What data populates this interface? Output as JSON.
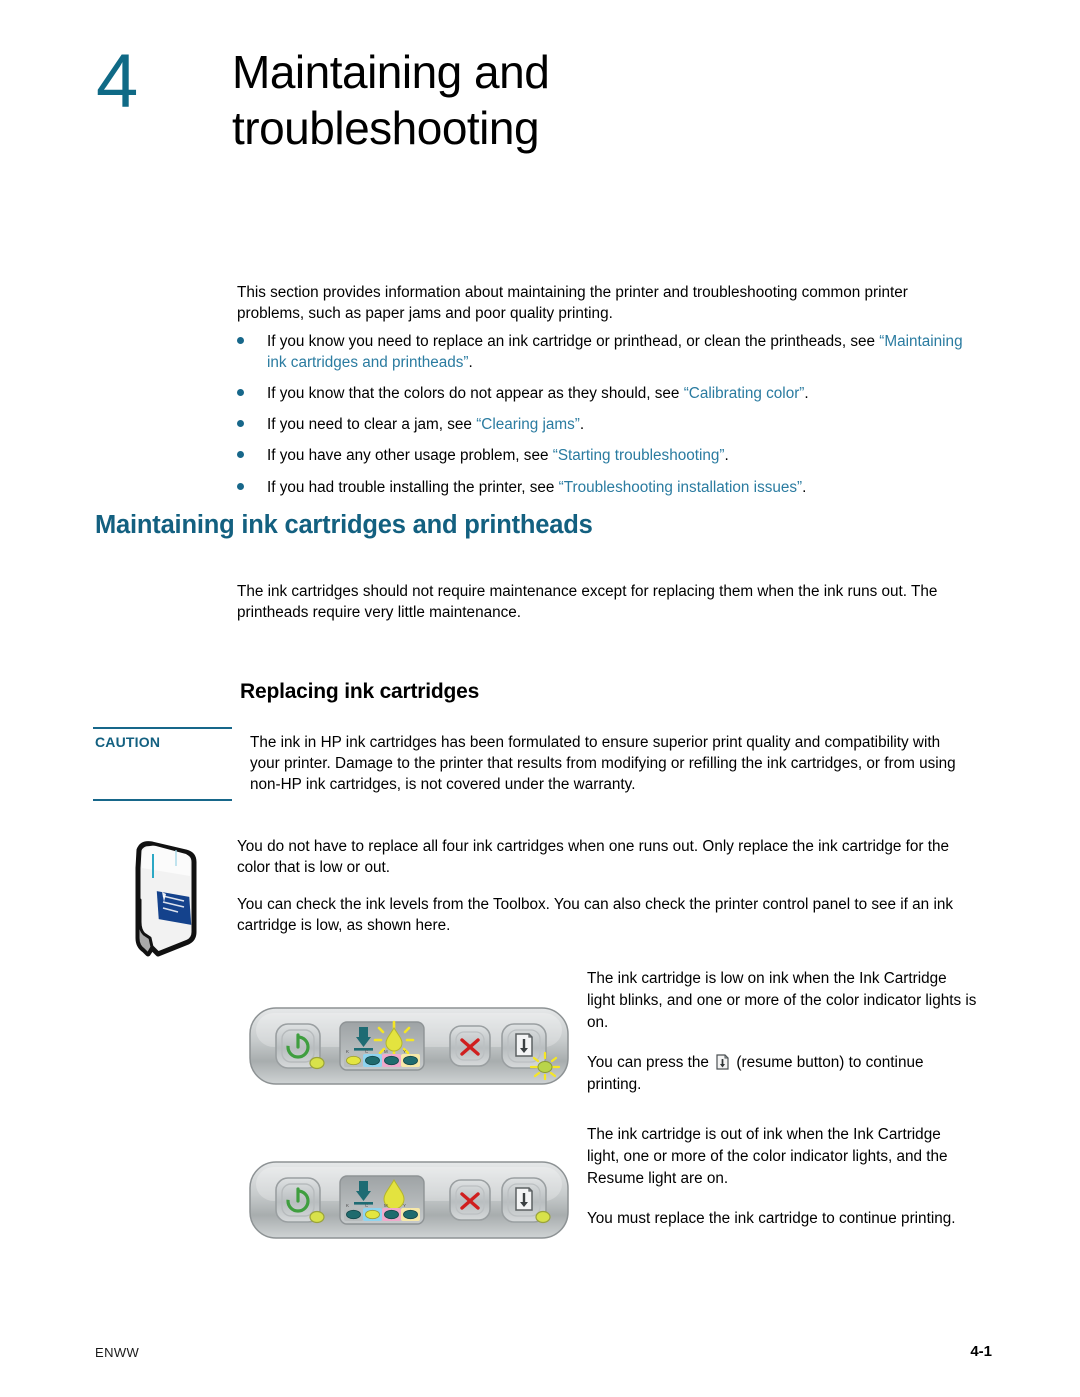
{
  "chapter": {
    "number": "4",
    "title_line1": "Maintaining and",
    "title_line2": "troubleshooting"
  },
  "intro": {
    "paragraph": "This section provides information about maintaining the printer and troubleshooting common printer problems, such as paper jams and poor quality printing."
  },
  "bullets": [
    {
      "lead": "If you know you need to replace an ink cartridge or printhead, or clean the printheads, see ",
      "link": "“Maintaining ink cartridges and printheads”",
      "tail": "."
    },
    {
      "lead": "If you know that the colors do not appear as they should, see ",
      "link": "“Calibrating color”",
      "tail": "."
    },
    {
      "lead": "If you need to clear a jam, see ",
      "link": "“Clearing jams”",
      "tail": "."
    },
    {
      "lead": "If you have any other usage problem, see ",
      "link": "“Starting troubleshooting”",
      "tail": "."
    },
    {
      "lead": "If you had trouble installing the printer, see ",
      "link": "“Troubleshooting installation issues”",
      "tail": "."
    }
  ],
  "section": {
    "heading": "Maintaining ink cartridges and printheads",
    "body": "The ink cartridges should not require maintenance except for replacing them when the ink runs out. The printheads require very little maintenance.",
    "subheading": "Replacing ink cartridges"
  },
  "caution": {
    "label": "CAUTION",
    "body": "The ink in HP ink cartridges has been formulated to ensure superior print quality and compatibility with your printer. Damage to the printer that results from modifying or refilling the ink cartridges, or from using non-HP ink cartridges, is not covered under the warranty."
  },
  "note": {
    "paragraph1": "You do not have to replace all four ink cartridges when one runs out. Only replace the ink cartridge for the color that is low or out.",
    "paragraph2": "You can check the ink levels from the Toolbox. You can also check the printer control panel to see if an ink cartridge is low, as shown here."
  },
  "panels": [
    {
      "caption_lead": "The ink cartridge is low on ink when the Ink Cartridge light blinks, and one or more of the color indicator lights is on.",
      "caption_part1": "You can press the ",
      "caption_part2": " (resume button) to continue printing.",
      "state": "low",
      "ink_drop_blinking": true,
      "resume_light_blinking": true,
      "lit_color_index": 0
    },
    {
      "caption_lead": "The ink cartridge is out of ink when the Ink Cartridge light, one or more of the color indicator lights, and the Resume light are on.",
      "caption_part1": "You must replace the ink cartridge to continue printing.",
      "caption_part2": "",
      "state": "out",
      "ink_drop_blinking": false,
      "resume_light_blinking": false,
      "lit_color_index": 1
    }
  ],
  "control_panel": {
    "color_labels": [
      "K",
      "C",
      "M",
      "Y"
    ],
    "color_backgrounds": [
      "#b8bcbd",
      "#8fd4ef",
      "#f0a9cb",
      "#f7e8a8"
    ],
    "lens_off_color": "#1f6b6e",
    "lens_on_color": "#e4e641",
    "power_icon": "power-icon",
    "cancel_icon": "cancel-x-icon",
    "resume_icon": "resume-page-icon",
    "printhead_icon": "printhead-icon",
    "ink_drop_icon": "ink-drop-icon"
  },
  "colors": {
    "chapter_number": "#0f6a86",
    "heading_teal": "#136080",
    "link_teal": "#2a7ba0",
    "bullet_teal": "#17678a",
    "caution_rule": "#17678a"
  },
  "footer": {
    "left": "ENWW",
    "right": "4-1"
  }
}
